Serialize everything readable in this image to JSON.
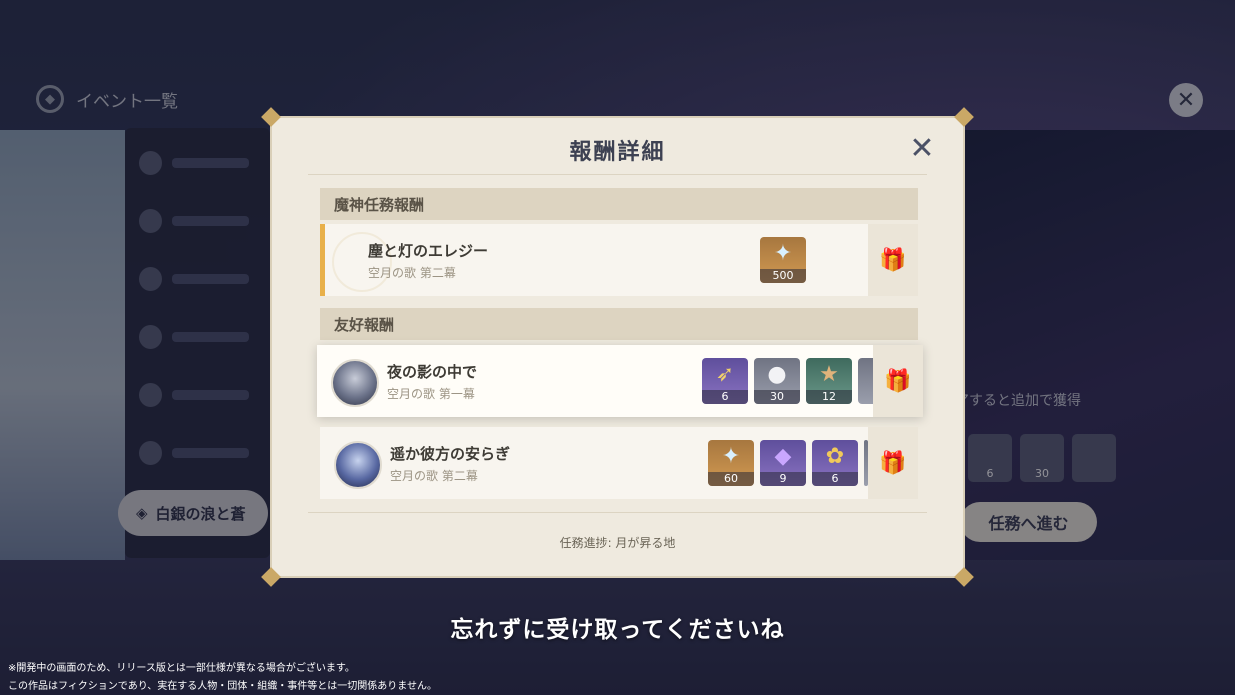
{
  "background": {
    "title": "イベント一覧",
    "event_button_label": "白銀の浪と蒼",
    "hint_text": "アすると追加で獲得",
    "progress_button_label": "任務へ進む",
    "rewards": [
      {
        "icon": "sunflower-icon",
        "count": "6"
      },
      {
        "icon": "pearl-icon",
        "count": "30"
      },
      {
        "icon": "crystal-icon",
        "count": ""
      }
    ]
  },
  "modal": {
    "title": "報酬詳細",
    "sections": [
      {
        "header": "魔神任務報酬",
        "rows": [
          {
            "title": "塵と灯のエレジー",
            "subtitle": "空月の歌 第二幕",
            "items": [
              {
                "icon": "primogem-icon",
                "color": "gold",
                "count": "500"
              }
            ]
          }
        ]
      },
      {
        "header": "友好報酬",
        "rows": [
          {
            "title": "夜の影の中で",
            "subtitle": "空月の歌 第一幕",
            "items": [
              {
                "icon": "weapon-sword-icon",
                "color": "purple",
                "count": "6"
              },
              {
                "icon": "pearl-icon",
                "color": "gray",
                "count": "30"
              },
              {
                "icon": "starfish-icon",
                "color": "green",
                "count": "12"
              },
              {
                "icon": "material-icon",
                "color": "gray",
                "count": ""
              }
            ]
          },
          {
            "title": "遥か彼方の安らぎ",
            "subtitle": "空月の歌 第二幕",
            "items": [
              {
                "icon": "primogem-icon",
                "color": "gold",
                "count": "60"
              },
              {
                "icon": "crystal-icon",
                "color": "purple",
                "count": "9"
              },
              {
                "icon": "sunflower-icon",
                "color": "purple",
                "count": "6"
              },
              {
                "icon": "material-icon",
                "color": "gray",
                "count": ""
              }
            ]
          }
        ]
      }
    ],
    "progress_label": "任務進捗: 月が昇る地"
  },
  "subtitle": "忘れずに受け取ってくださいね",
  "disclaimers": [
    "※開発中の画面のため、リリース版とは一部仕様が異なる場合がございます。",
    "この作品はフィクションであり、実在する人物・団体・組織・事件等とは一切関係ありません。"
  ],
  "colors": {
    "accent": "#e8b04a",
    "modal_bg": "#efeadf",
    "header_bg": "#ddd4c1"
  }
}
